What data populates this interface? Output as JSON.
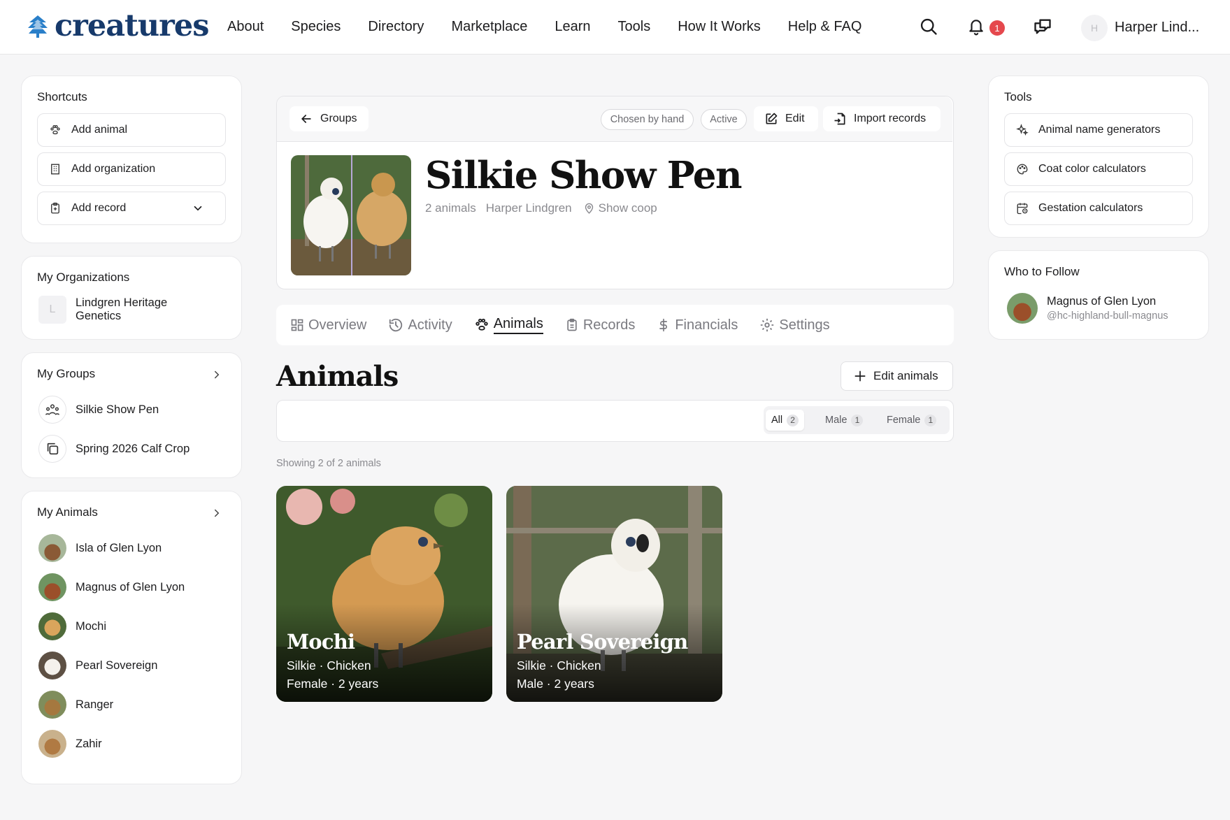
{
  "brand": {
    "name": "creatures",
    "color": "#173a6b"
  },
  "nav": [
    "About",
    "Species",
    "Directory",
    "Marketplace",
    "Learn",
    "Tools",
    "How It Works",
    "Help & FAQ"
  ],
  "header": {
    "notification_count": "1",
    "user_initial": "H",
    "user_name": "Harper Lind..."
  },
  "shortcuts": {
    "title": "Shortcuts",
    "items": [
      {
        "label": "Add animal",
        "icon": "paw-icon"
      },
      {
        "label": "Add organization",
        "icon": "building-icon"
      },
      {
        "label": "Add record",
        "icon": "clipboard-icon"
      }
    ]
  },
  "organizations": {
    "title": "My Organizations",
    "items": [
      {
        "initial": "L",
        "name": "Lindgren Heritage Genetics"
      }
    ]
  },
  "groups": {
    "title": "My Groups",
    "items": [
      {
        "name": "Silkie Show Pen"
      },
      {
        "name": "Spring 2026 Calf Crop"
      }
    ]
  },
  "my_animals": {
    "title": "My Animals",
    "items": [
      {
        "name": "Isla of Glen Lyon"
      },
      {
        "name": "Magnus of Glen Lyon"
      },
      {
        "name": "Mochi"
      },
      {
        "name": "Pearl Sovereign"
      },
      {
        "name": "Ranger"
      },
      {
        "name": "Zahir"
      }
    ]
  },
  "group": {
    "back_label": "Groups",
    "tags": [
      "Chosen by hand",
      "Active"
    ],
    "edit_label": "Edit",
    "import_label": "Import records",
    "title": "Silkie Show Pen",
    "meta": {
      "animals": "2 animals",
      "owner": "Harper Lindgren",
      "location": "Show coop"
    }
  },
  "tabs": [
    "Overview",
    "Activity",
    "Animals",
    "Records",
    "Financials",
    "Settings"
  ],
  "active_tab": "Animals",
  "animals_section": {
    "title": "Animals",
    "edit_button": "Edit animals",
    "filters": [
      {
        "label": "All",
        "count": "2",
        "selected": true
      },
      {
        "label": "Male",
        "count": "1",
        "selected": false
      },
      {
        "label": "Female",
        "count": "1",
        "selected": false
      }
    ],
    "showing": "Showing 2 of 2 animals",
    "cards": [
      {
        "name": "Mochi",
        "breed": "Silkie · Chicken",
        "details": "Female · 2 years"
      },
      {
        "name": "Pearl Sovereign",
        "breed": "Silkie · Chicken",
        "details": "Male · 2 years"
      }
    ]
  },
  "tools": {
    "title": "Tools",
    "items": [
      {
        "label": "Animal name generators",
        "icon": "sparkle-icon"
      },
      {
        "label": "Coat color calculators",
        "icon": "palette-icon"
      },
      {
        "label": "Gestation calculators",
        "icon": "calendar-clock-icon"
      }
    ]
  },
  "who_to_follow": {
    "title": "Who to Follow",
    "items": [
      {
        "name": "Magnus of Glen Lyon",
        "handle": "@hc-highland-bull-magnus"
      }
    ]
  }
}
